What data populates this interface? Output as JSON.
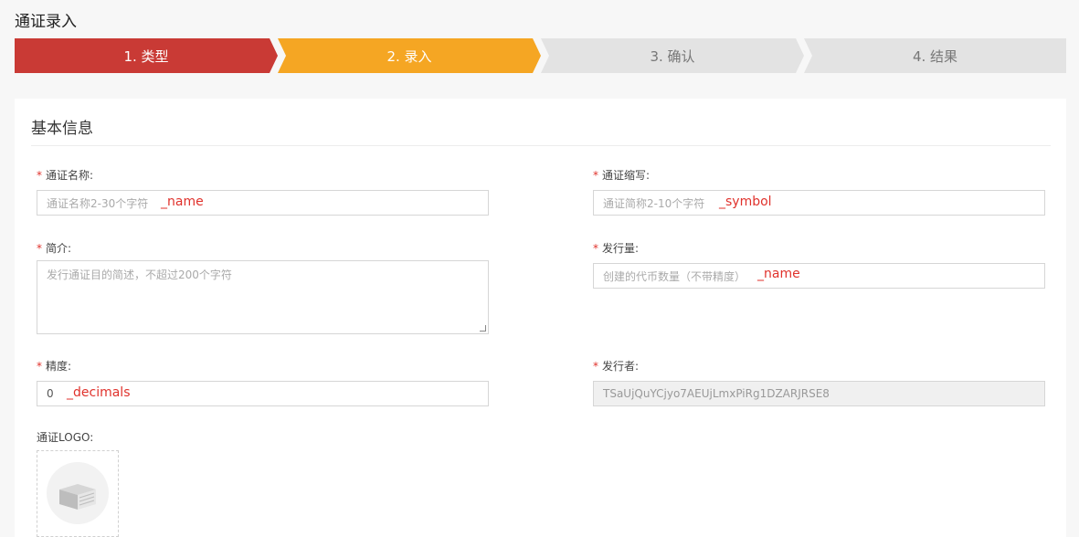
{
  "page": {
    "title": "通证录入"
  },
  "steps": [
    {
      "label": "1. 类型",
      "state": "done"
    },
    {
      "label": "2. 录入",
      "state": "active"
    },
    {
      "label": "3. 确认",
      "state": "pending"
    },
    {
      "label": "4. 结果",
      "state": "pending"
    }
  ],
  "section": {
    "title": "基本信息"
  },
  "form": {
    "required_mark": "*",
    "name": {
      "label": "通证名称:",
      "placeholder": "通证名称2-30个字符",
      "annotation": "_name"
    },
    "symbol": {
      "label": "通证缩写:",
      "placeholder": "通证简称2-10个字符",
      "annotation": "_symbol"
    },
    "intro": {
      "label": "简介:",
      "placeholder": "发行通证目的简述，不超过200个字符"
    },
    "supply": {
      "label": "发行量:",
      "placeholder": "创建的代币数量（不带精度）",
      "annotation": "_name"
    },
    "decimals": {
      "label": "精度:",
      "value": "0",
      "annotation": "_decimals"
    },
    "issuer": {
      "label": "发行者:",
      "value": "TSaUjQuYCjyo7AEUjLmxPiRg1DZARJRSE8"
    },
    "logo": {
      "label": "通证LOGO:"
    }
  },
  "colors": {
    "step_done": "#c93a35",
    "step_active": "#f5a623",
    "step_pending": "#e3e3e3",
    "required": "#e0322c",
    "annotation": "#e0322c"
  }
}
